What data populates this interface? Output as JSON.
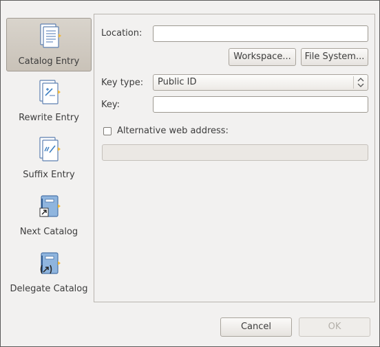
{
  "sidebar": {
    "items": [
      {
        "label": "Catalog Entry",
        "icon": "catalog-entry-icon",
        "selected": true
      },
      {
        "label": "Rewrite Entry",
        "icon": "rewrite-entry-icon",
        "selected": false
      },
      {
        "label": "Suffix Entry",
        "icon": "suffix-entry-icon",
        "selected": false
      },
      {
        "label": "Next Catalog",
        "icon": "next-catalog-icon",
        "selected": false
      },
      {
        "label": "Delegate Catalog",
        "icon": "delegate-catalog-icon",
        "selected": false
      }
    ]
  },
  "form": {
    "location_label": "Location:",
    "location_value": "",
    "workspace_button": "Workspace...",
    "filesystem_button": "File System...",
    "key_type_label": "Key type:",
    "key_type_value": "Public ID",
    "key_label": "Key:",
    "key_value": "",
    "alt_web_checkbox_checked": false,
    "alt_web_label": "Alternative web address:",
    "alt_web_value": ""
  },
  "footer": {
    "cancel_button": "Cancel",
    "ok_button": "OK"
  },
  "colors": {
    "accent_blue": "#3d7fc1",
    "icon_yellow": "#f2b93b",
    "selected_bg": "#cfc9bf"
  }
}
